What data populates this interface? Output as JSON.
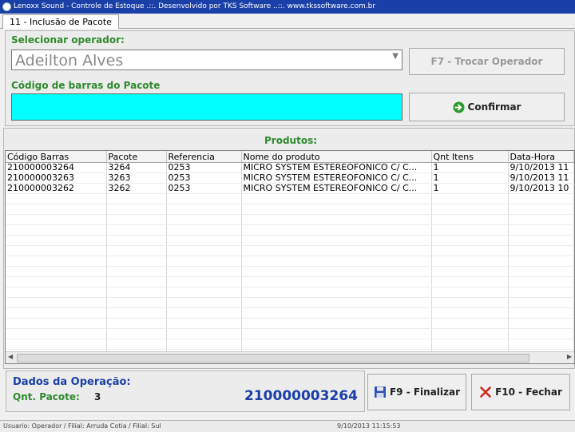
{
  "window": {
    "title": "Lenoxx Sound - Controle de Estoque .::. Desenvolvido por TKS Software ..::. www.tkssoftware.com.br"
  },
  "tab": {
    "label": "11 - Inclusão de Pacote"
  },
  "operator": {
    "label": "Selecionar operador:",
    "value": "Adeilton Alves",
    "change_button": "F7 - Trocar Operador"
  },
  "barcode": {
    "label": "Código de barras do Pacote",
    "value": "",
    "confirm_button": "Confirmar"
  },
  "products": {
    "title": "Produtos:",
    "columns": [
      "Código Barras",
      "Pacote",
      "Referencia",
      "Nome do produto",
      "Qnt Itens",
      "Data-Hora"
    ],
    "rows": [
      [
        "210000003264",
        "3264",
        "0253",
        "MICRO SYSTEM ESTEREOFONICO C/ C...",
        "1",
        "9/10/2013 11"
      ],
      [
        "210000003263",
        "3263",
        "0253",
        "MICRO SYSTEM ESTEREOFONICO C/ C...",
        "1",
        "9/10/2013 11"
      ],
      [
        "210000003262",
        "3262",
        "0253",
        "MICRO SYSTEM ESTEREOFONICO C/ C...",
        "1",
        "9/10/2013 10"
      ]
    ]
  },
  "operation": {
    "title": "Dados da Operação:",
    "qnt_label": "Qnt. Pacote:",
    "qnt_value": "3",
    "last_barcode": "210000003264",
    "finish_button": "F9 - Finalizar",
    "close_button": "F10 - Fechar"
  },
  "status": {
    "left": "Usuario: Operador / Filial: Arruda Cotia / Filial: Sul",
    "datetime": "9/10/2013 11:15:53"
  },
  "colors": {
    "title_bar": "#1a40a8",
    "green_label": "#2f8a2f",
    "blue_label": "#1a3fa8",
    "barcode_field": "#00ffff"
  }
}
